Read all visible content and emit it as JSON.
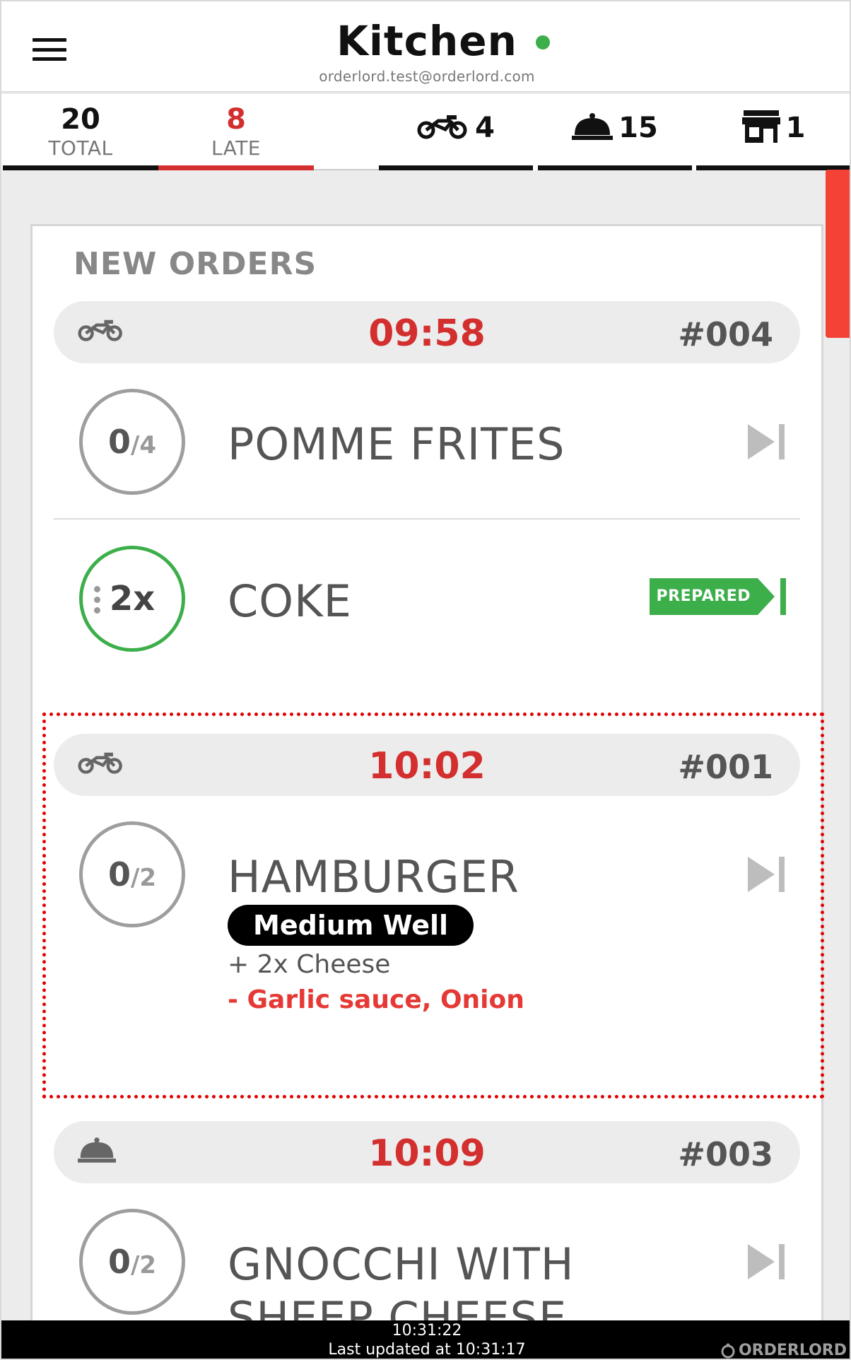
{
  "header": {
    "title": "Kitchen",
    "status_color": "#3cae4a",
    "subtitle": "orderlord.test@orderlord.com",
    "menu_icon": "hamburger-menu-icon"
  },
  "stats": {
    "total": {
      "count": "20",
      "label": "TOTAL"
    },
    "late": {
      "count": "8",
      "label": "LATE"
    },
    "delivery": {
      "icon": "motorbike-icon",
      "count": "4"
    },
    "dine_in": {
      "icon": "cloche-icon",
      "count": "15"
    },
    "takeaway": {
      "icon": "store-icon",
      "count": "1"
    }
  },
  "section": {
    "title": "NEW ORDERS"
  },
  "orders": [
    {
      "type_icon": "motorbike-icon",
      "time": "09:58",
      "number": "#004",
      "items": [
        {
          "qty": "0",
          "total": "/4",
          "name": "POMME FRITES",
          "action": "skip-to-end-icon"
        },
        {
          "qty": "2x",
          "name": "COKE",
          "action_label": "PREPARED"
        }
      ]
    },
    {
      "type_icon": "motorbike-icon",
      "time": "10:02",
      "number": "#001",
      "items": [
        {
          "qty": "0",
          "total": "/2",
          "name": "HAMBURGER",
          "cooking": "Medium Well",
          "add": "+ 2x Cheese",
          "remove": "- Garlic sauce, Onion",
          "action": "skip-to-end-icon"
        }
      ]
    },
    {
      "type_icon": "cloche-icon",
      "time": "10:09",
      "number": "#003",
      "items": [
        {
          "qty": "0",
          "total": "/2",
          "name_line1": "GNOCCHI WITH",
          "name_line2": "SHEEP CHEESE",
          "action": "skip-to-end-icon"
        }
      ]
    }
  ],
  "footer": {
    "clock": "10:31:22",
    "updated": "Last updated at 10:31:17",
    "brand": "ORDERLORD"
  },
  "colors": {
    "late_red": "#d32f2f",
    "prepared_green": "#3cae4a",
    "scroll_red": "#f44336"
  }
}
